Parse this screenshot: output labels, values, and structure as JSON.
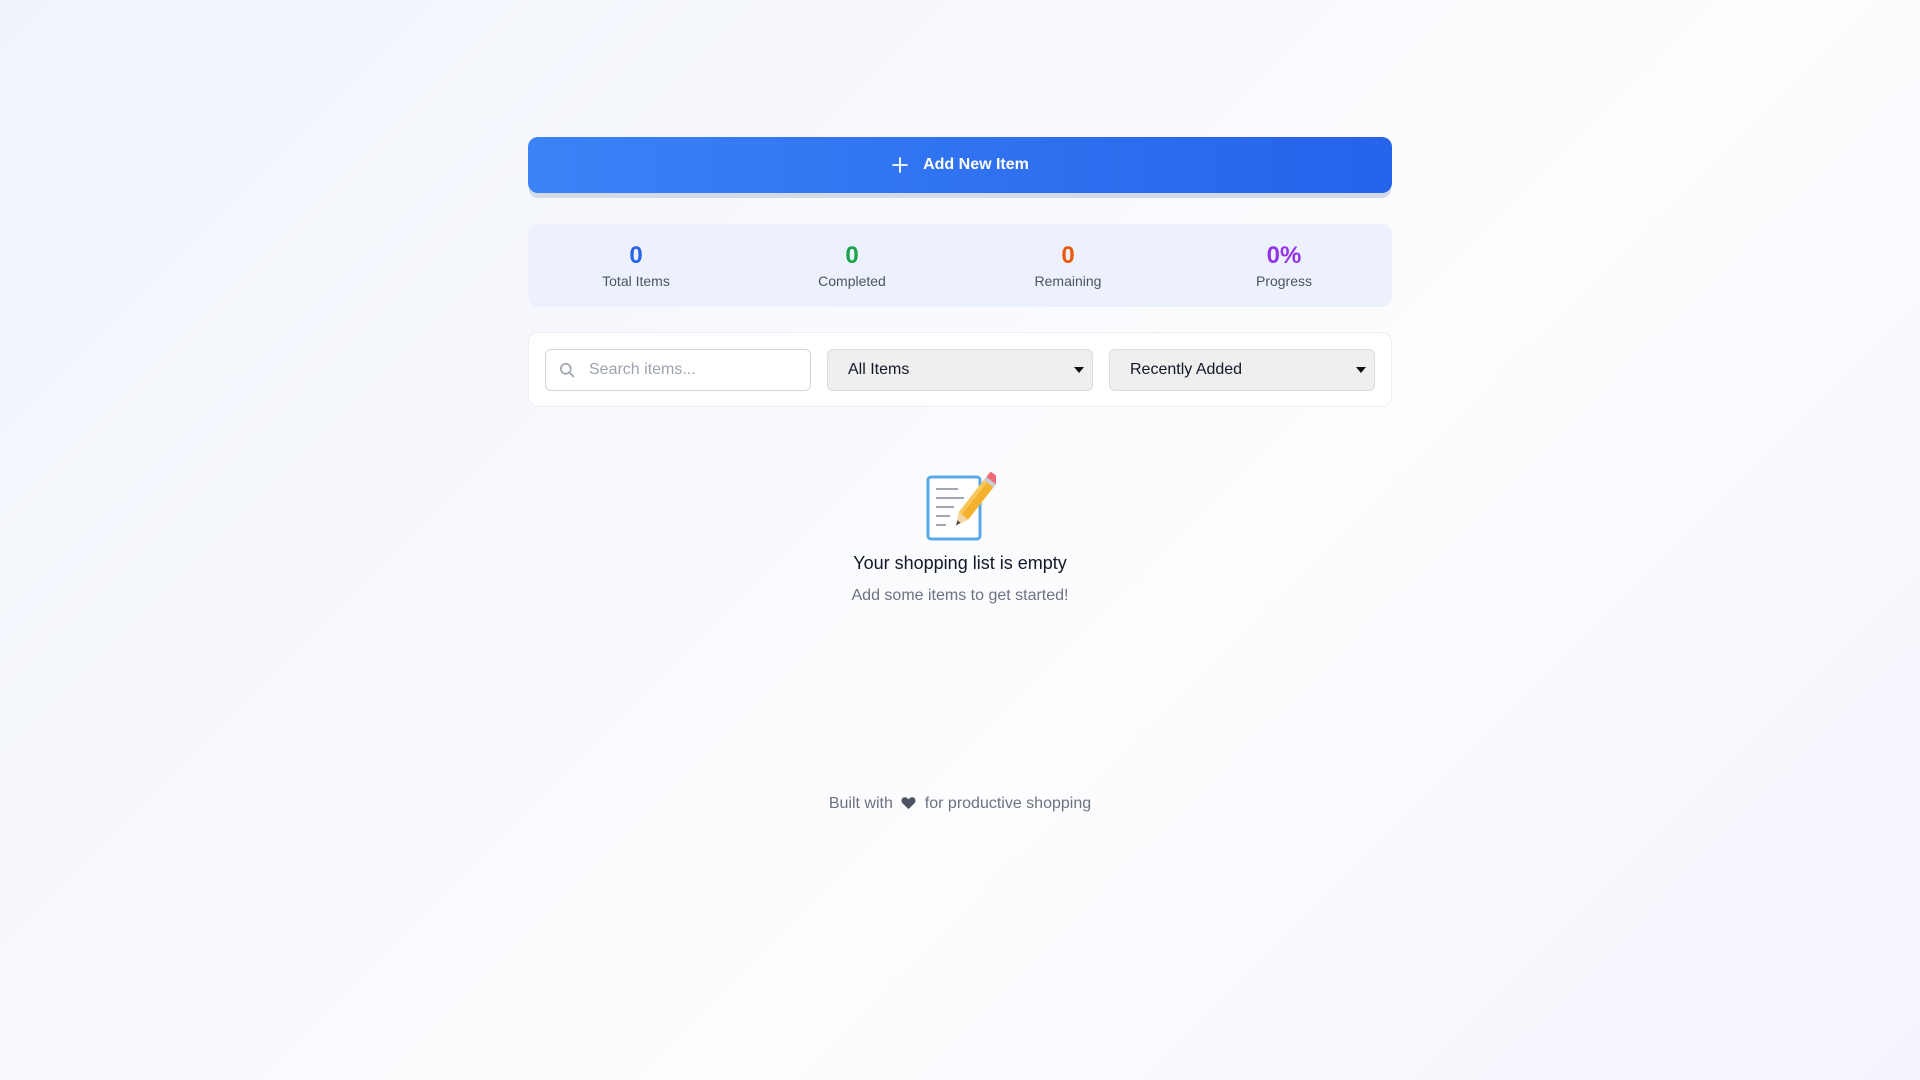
{
  "header": {
    "add_button_label": "Add New Item"
  },
  "stats": [
    {
      "value": "0",
      "label": "Total Items",
      "color": "#2563eb"
    },
    {
      "value": "0",
      "label": "Completed",
      "color": "#16a34a"
    },
    {
      "value": "0",
      "label": "Remaining",
      "color": "#ea580c"
    },
    {
      "value": "0%",
      "label": "Progress",
      "color": "#9333ea"
    }
  ],
  "filters": {
    "search_placeholder": "Search items...",
    "search_value": "",
    "status_filter": "All Items",
    "sort_order": "Recently Added"
  },
  "empty_state": {
    "icon": "memo-icon",
    "title": "Your shopping list is empty",
    "subtitle": "Add some items to get started!"
  },
  "footer": {
    "text_before": "Built with",
    "icon": "heart-icon",
    "text_after": "for productive shopping"
  },
  "colors": {
    "accent": "#3b82f6",
    "accent_dark": "#2563eb"
  }
}
